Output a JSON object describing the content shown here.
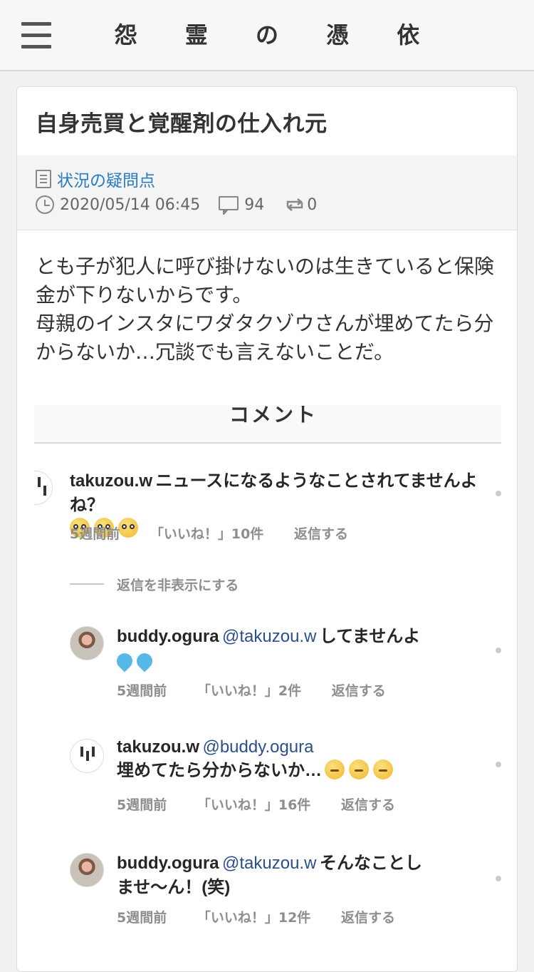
{
  "header": {
    "title": "怨 霊 の 憑 依"
  },
  "post": {
    "title": "自身売買と覚醒剤の仕入れ元",
    "category": "状況の疑問点",
    "date": "2020/05/14 06:45",
    "comments": "94",
    "retweets": "0",
    "body": [
      "とも子が犯人に呼び掛けないのは生きていると保険金が下りないからです。",
      "母親のインスタにワダタクゾウさんが埋めてたら分からないか…冗談でも言えないことだ。"
    ]
  },
  "embed": {
    "heading": "コメント",
    "hide_replies": "返信を非表示にする",
    "comments": [
      {
        "user": "takuzou.w",
        "mention": "",
        "text": "ニュースになるようなことされてませんよね？",
        "time": "5週間前",
        "likes": "「いいね！」10件",
        "reply": "返信する"
      },
      {
        "user": "buddy.ogura",
        "mention": "@takuzou.w",
        "text": "してませんよ",
        "time": "5週間前",
        "likes": "「いいね！」2件",
        "reply": "返信する"
      },
      {
        "user": "takuzou.w",
        "mention": "@buddy.ogura",
        "text": "埋めてたら分からないか…",
        "time": "5週間前",
        "likes": "「いいね！」16件",
        "reply": "返信する"
      },
      {
        "user": "buddy.ogura",
        "mention": "@takuzou.w",
        "text": "そんなことし",
        "text2": "ませ〜ん！(笑)",
        "time": "5週間前",
        "likes": "「いいね！」12件",
        "reply": "返信する"
      }
    ]
  },
  "colors": {
    "link": "#2a7bbf",
    "mention": "#2a4f8a"
  }
}
